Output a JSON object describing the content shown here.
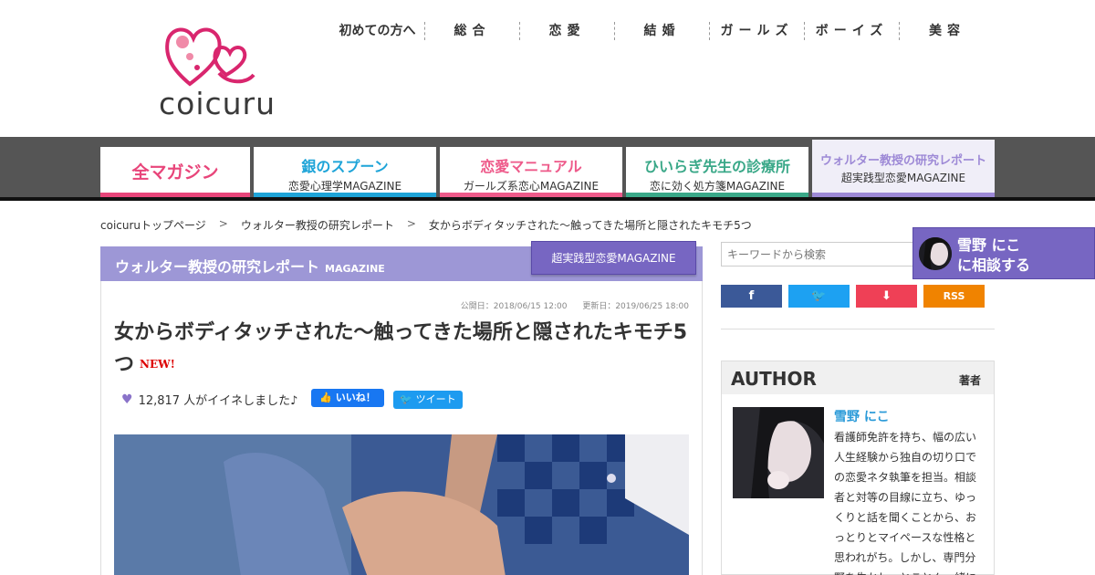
{
  "brand": {
    "logo_text": "coicuru",
    "pink": "#d9266e",
    "pink_light": "#f08aa8"
  },
  "topnav": [
    {
      "label": "初めての方へ"
    },
    {
      "label": "総合"
    },
    {
      "label": "恋愛"
    },
    {
      "label": "結婚"
    },
    {
      "label": "ガールズ"
    },
    {
      "label": "ボーイズ"
    },
    {
      "label": "美容"
    }
  ],
  "categories": [
    {
      "title": "全マガジン",
      "subtitle": "",
      "color": "#e8457a"
    },
    {
      "title": "銀のスプーン",
      "subtitle": "恋愛心理学MAGAZINE",
      "color": "#1ea4d8"
    },
    {
      "title": "恋愛マニュアル",
      "subtitle": "ガールズ系恋心MAGAZINE",
      "color": "#ee5a8a"
    },
    {
      "title": "ひいらぎ先生の診療所",
      "subtitle": "恋に効く処方箋MAGAZINE",
      "color": "#3aa888"
    },
    {
      "title": "ウォルター教授の研究レポート",
      "subtitle": "超実践型恋愛MAGAZINE",
      "color": "#9d89d6"
    }
  ],
  "breadcrumb": {
    "items": [
      "coicuruトップページ",
      "ウォルター教授の研究レポート",
      "女からボディタッチされた～触ってきた場所と隠されたキモチ5つ"
    ],
    "separator": ">"
  },
  "magazine": {
    "title": "ウォルター教授の研究レポート",
    "sub": "MAGAZINE",
    "badge": "超実践型恋愛MAGAZINE",
    "color": "#9d97d6"
  },
  "article": {
    "published": "公開日：2018/06/15 12:00",
    "updated": "更新日：2019/06/25 18:00",
    "title": "女からボディタッチされた～触ってきた場所と隠されたキモチ5つ",
    "new_label": "NEW!",
    "likes_text": "12,817 人がイイネしました♪",
    "fb_label": "いいね！",
    "tw_label": "ツイート"
  },
  "sidebar": {
    "search_placeholder": "キーワードから検索",
    "share": [
      {
        "label": "f",
        "color": "#3b5998",
        "icon": "facebook-icon"
      },
      {
        "label": "🐦",
        "color": "#1da1f2",
        "icon": "twitter-icon"
      },
      {
        "label": "⬇",
        "color": "#ef4056",
        "icon": "pocket-icon"
      },
      {
        "label": "RSS",
        "color": "#f08300",
        "icon": "rss-icon"
      }
    ],
    "author": {
      "heading": "AUTHOR",
      "tag": "著者",
      "name": "雪野 にこ",
      "bio": "看護師免許を持ち、幅の広い人生経験から独自の切り口での恋愛ネタ執筆を担当。相談者と対等の目線に立ち、ゆっくりと話を聞くことから、おっとりとマイペースな性格と思われがち。しかし、専門分野を生かし、とことん一緒に"
    }
  },
  "consult": {
    "line1": "雪野 にこ",
    "line2": "に相談する"
  }
}
